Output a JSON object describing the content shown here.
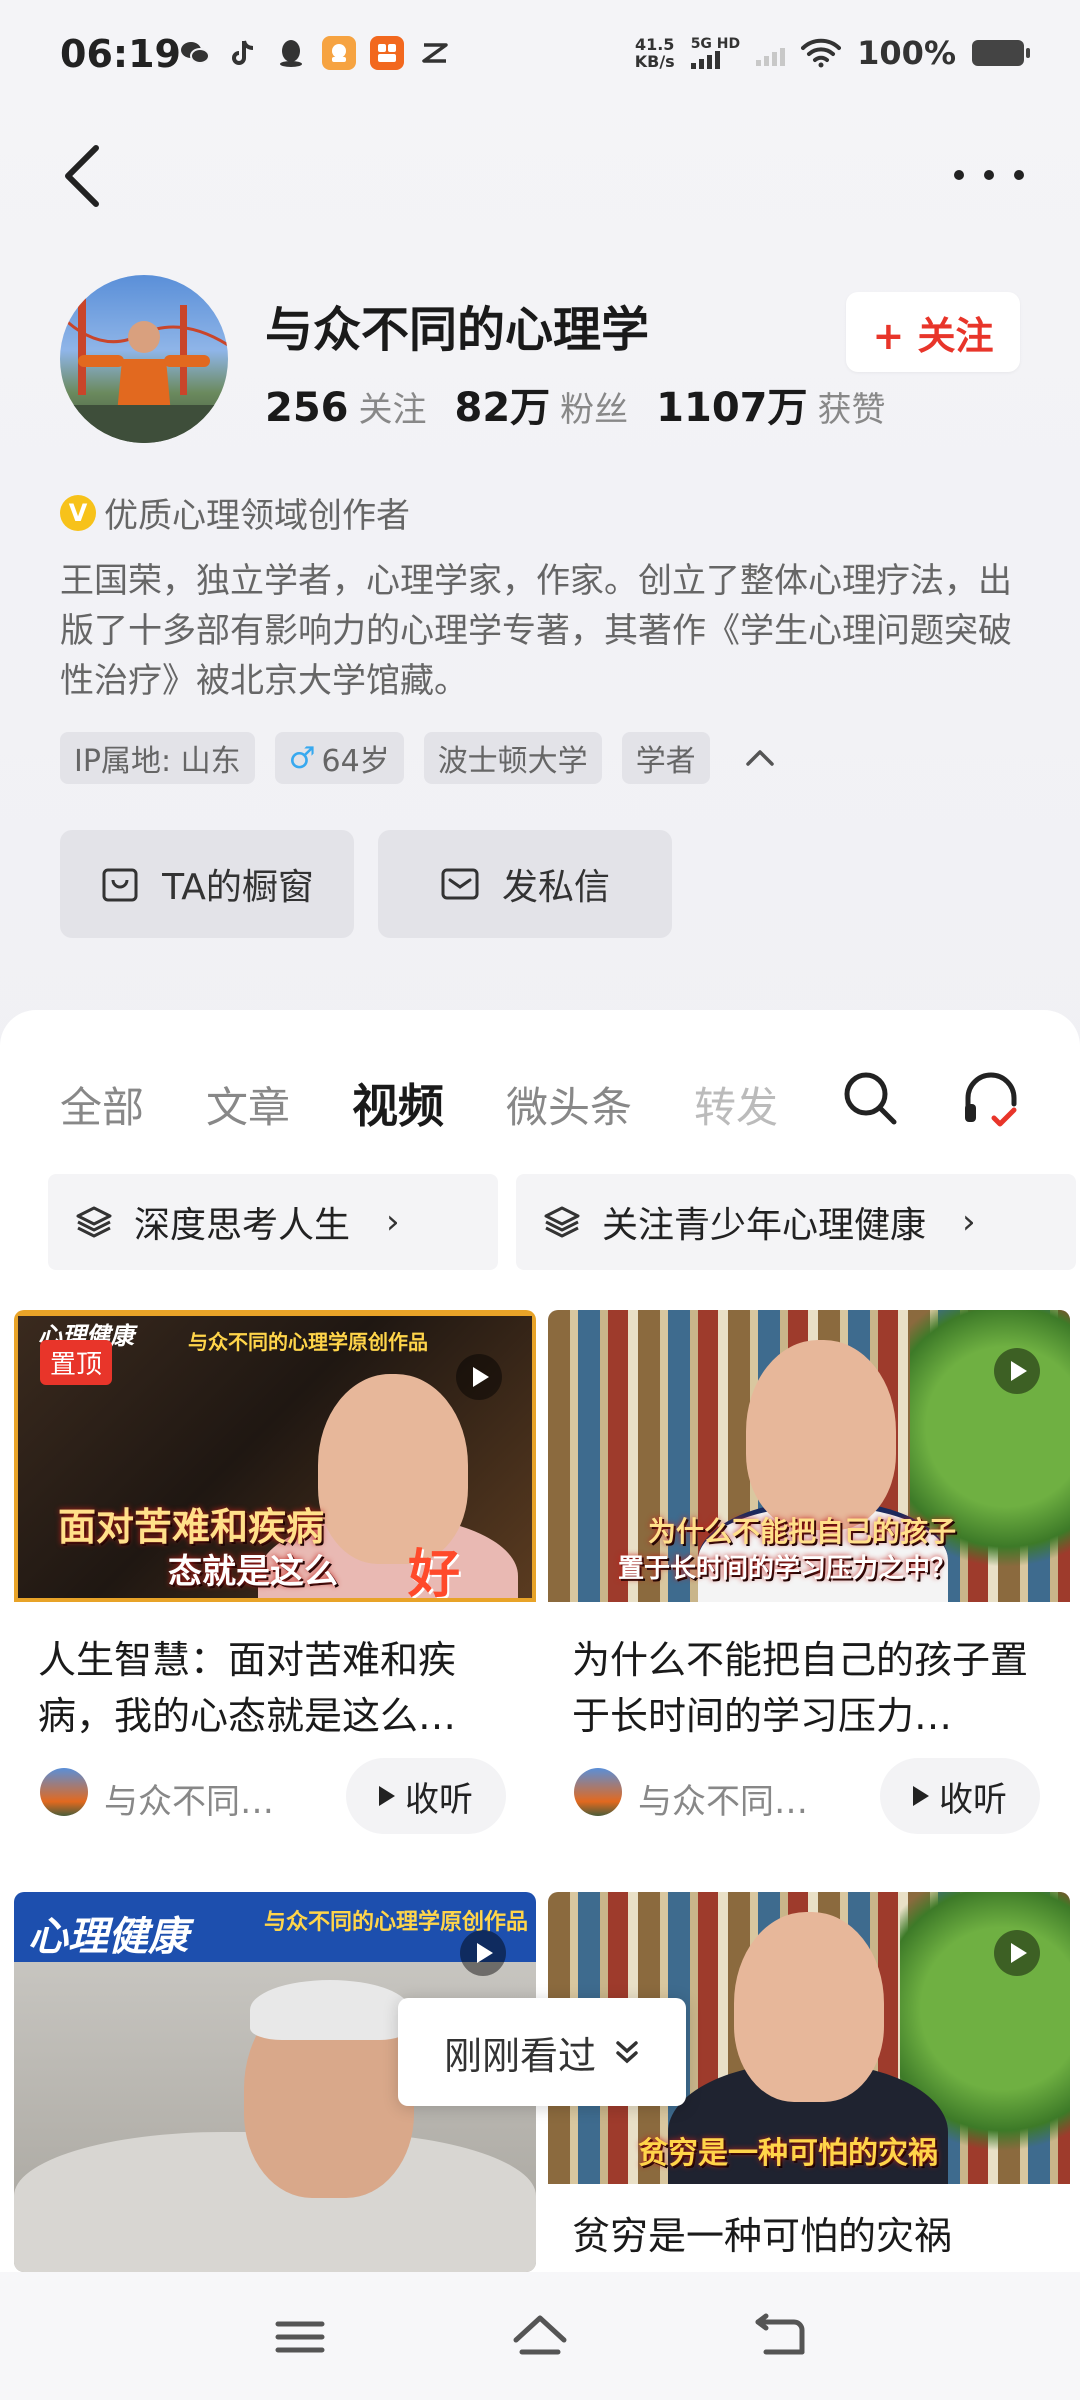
{
  "status_bar": {
    "time": "06:19",
    "net_speed_value": "41.5",
    "net_speed_unit": "KB/s",
    "signal_label": "5G HD",
    "battery": "100%"
  },
  "profile": {
    "name": "与众不同的心理学",
    "follow_label": "+ 关注",
    "stats": [
      {
        "num": "256",
        "label": "关注"
      },
      {
        "num": "82万",
        "label": "粉丝"
      },
      {
        "num": "1107万",
        "label": "获赞"
      }
    ],
    "verified_badge": "V",
    "verified_text": "优质心理领域创作者",
    "bio": "王国荣，独立学者，心理学家，作家。创立了整体心理疗法，出版了十多部有影响力的心理学专著，其著作《学生心理问题突破性治疗》被北京大学馆藏。",
    "tags": {
      "ip": "IP属地: 山东",
      "age_symbol": "♂",
      "age": "64岁",
      "school": "波士顿大学",
      "role": "学者"
    },
    "shop_label": "TA的橱窗",
    "message_label": "发私信"
  },
  "tabs": [
    {
      "label": "全部"
    },
    {
      "label": "文章"
    },
    {
      "label": "视频"
    },
    {
      "label": "微头条"
    },
    {
      "label": "转发"
    }
  ],
  "collections": [
    {
      "label": "深度思考人生"
    },
    {
      "label": "关注青少年心理健康"
    }
  ],
  "cards": [
    {
      "title": "人生智慧：面对苦难和疾病，我的心态就是这么…",
      "author": "与众不同…",
      "listen": "收听",
      "pin": "置顶",
      "thumb_top": "心理健康",
      "thumb_source": "与众不同的心理学原创作品",
      "thumb_caption_1": "面对苦难和疾病",
      "thumb_caption_2": "态就是这么",
      "thumb_caption_3": "好"
    },
    {
      "title": "为什么不能把自己的孩子置于长时间的学习压力…",
      "author": "与众不同…",
      "listen": "收听",
      "thumb_caption_1": "为什么不能把自己的孩子",
      "thumb_caption_2": "置于长时间的学习压力之中？"
    },
    {
      "title": "",
      "thumb_top": "心理健康",
      "thumb_source": "与众不同的心理学原创作品"
    },
    {
      "title": "贫穷是一种可怕的灾祸",
      "thumb_caption_1": "贫穷是一种可怕的灾祸"
    }
  ],
  "recent_toast": "刚刚看过",
  "colors": {
    "accent_red": "#e8352a",
    "verified_yellow": "#f7c21a",
    "male_blue": "#38a9ef"
  }
}
